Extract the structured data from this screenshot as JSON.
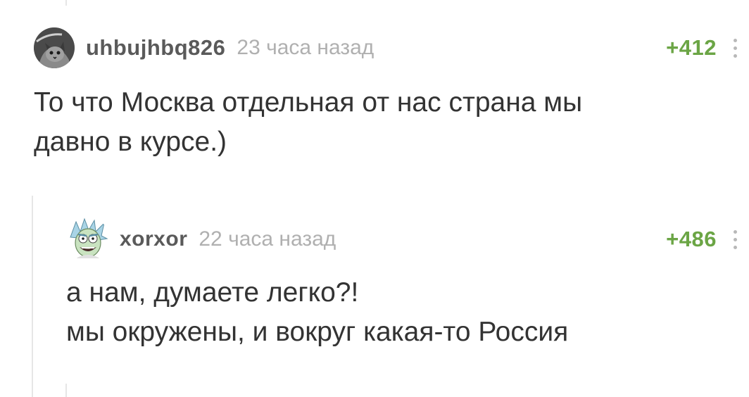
{
  "comments": [
    {
      "author": "uhbujhbq826",
      "time": "23 часа назад",
      "rating": "+412",
      "avatar_icon": "cat-avatar-icon",
      "text_lines": [
        "То что Москва отдельная от нас страна мы",
        "давно в курсе.)"
      ]
    },
    {
      "author": "xorxor",
      "time": "22 часа назад",
      "rating": "+486",
      "avatar_icon": "cartoon-scientist-avatar-icon",
      "text_lines": [
        "а нам, думаете легко?!",
        "мы окружены, и вокруг какая-то Россия"
      ]
    }
  ],
  "colors": {
    "rating_positive": "#6ba545",
    "username": "#5a5a5a",
    "timestamp": "#b0b0b0",
    "body_text": "#333333",
    "thread_line": "#e6e6e6"
  }
}
